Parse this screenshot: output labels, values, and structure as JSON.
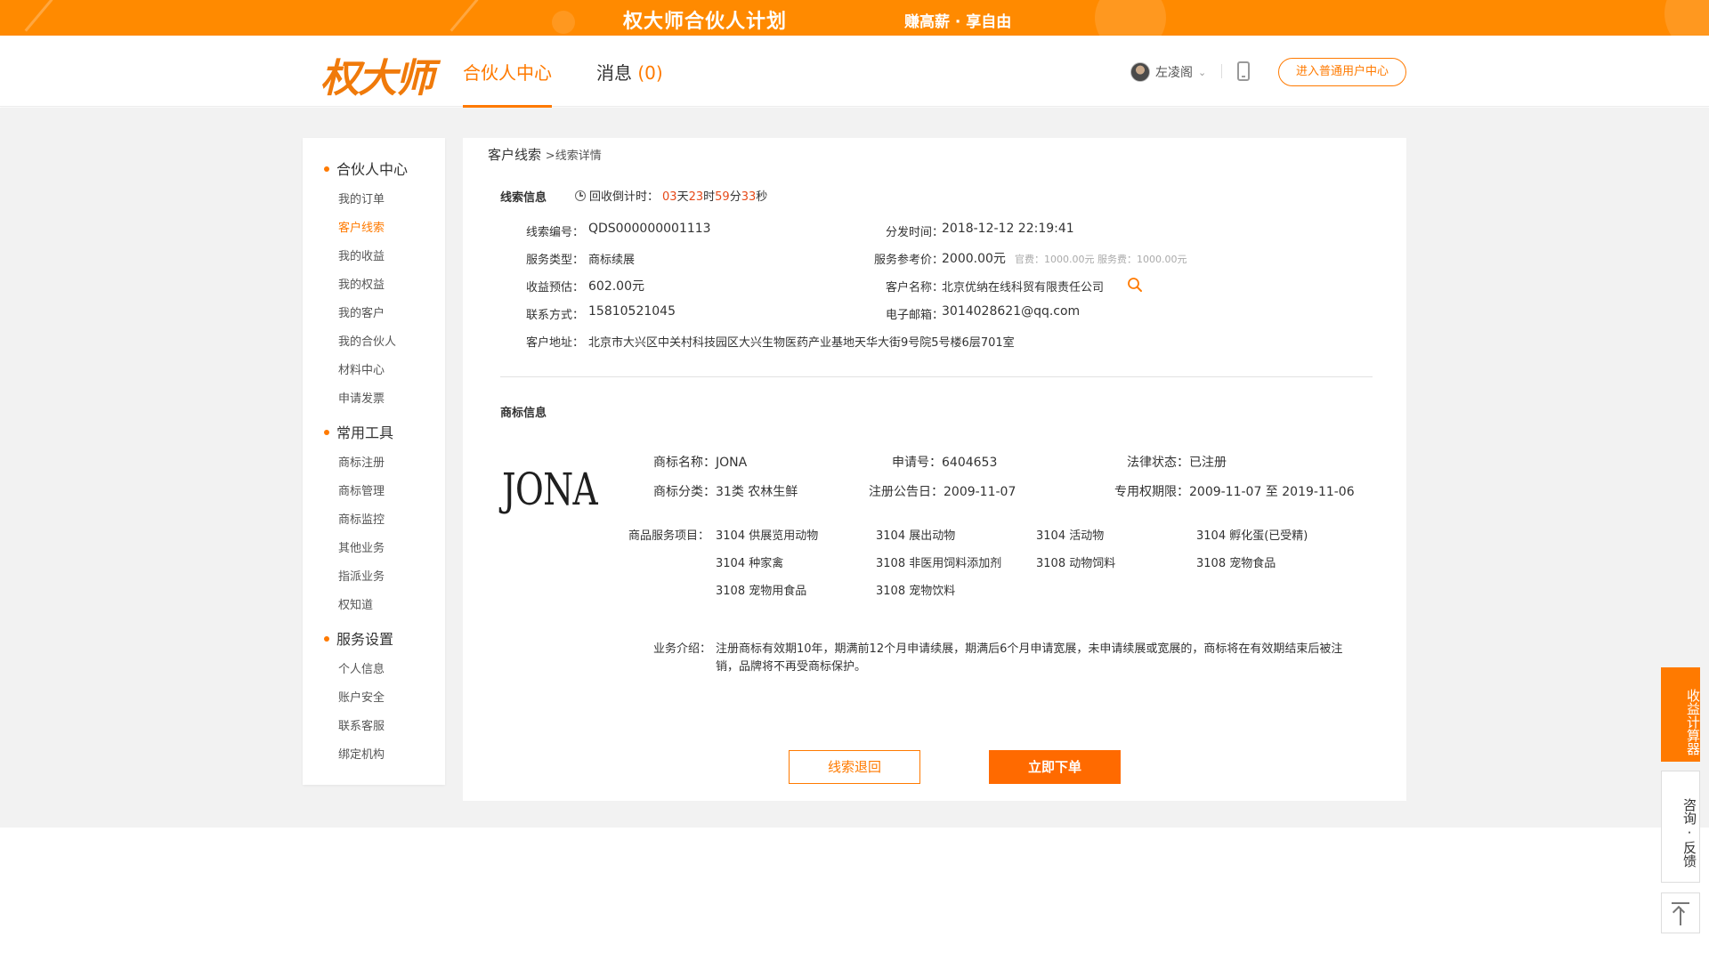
{
  "banner": {
    "title": "权大师合伙人计划",
    "slogan": "赚高薪 · 享自由"
  },
  "header": {
    "logo": "权大师",
    "nav_partner": "合伙人中心",
    "nav_messages": "消息",
    "nav_messages_count": "(0)",
    "username": "左凌阁",
    "user_center_button": "进入普通用户中心"
  },
  "sidebar": {
    "sections": [
      {
        "title": "合伙人中心",
        "items": [
          "我的订单",
          "客户线索",
          "我的收益",
          "我的权益",
          "我的客户",
          "我的合伙人",
          "材料中心",
          "申请发票"
        ]
      },
      {
        "title": "常用工具",
        "items": [
          "商标注册",
          "商标管理",
          "商标监控",
          "其他业务",
          "指派业务",
          "权知道"
        ]
      },
      {
        "title": "服务设置",
        "items": [
          "个人信息",
          "账户安全",
          "联系客服",
          "绑定机构"
        ]
      }
    ],
    "active_item": "客户线索"
  },
  "breadcrumb": {
    "parent": "客户线索",
    "current": ">线索详情"
  },
  "lead_info": {
    "heading": "线索信息",
    "countdown_label": "回收倒计时：",
    "days": "03",
    "days_unit": "天",
    "hours": "23",
    "hours_unit": "时",
    "minutes": "59",
    "minutes_unit": "分",
    "seconds": "33",
    "seconds_unit": "秒",
    "lead_no_label": "线索编号：",
    "lead_no": "QDS000000001113",
    "dispatch_time_label": "分发时间：",
    "dispatch_time": "2018-12-12 22:19:41",
    "service_type_label": "服务类型：",
    "service_type": "商标续展",
    "ref_price_label": "服务参考价：",
    "ref_price": "2000.00元",
    "fee_note": "官费：1000.00元 服务费：1000.00元",
    "income_label": "收益预估：",
    "income": "602.00元",
    "customer_name_label": "客户名称：",
    "customer_name": "北京优纳在线科贸有限责任公司",
    "contact_label": "联系方式：",
    "contact": "15810521045",
    "email_label": "电子邮箱：",
    "email": "3014028621@qq.com",
    "address_label": "客户地址：",
    "address": "北京市大兴区中关村科技园区大兴生物医药产业基地天华大街9号院5号楼6层701室"
  },
  "trademark": {
    "heading": "商标信息",
    "image_text": "JONA",
    "name": "商标名称：JONA",
    "app_no": "申请号：6404653",
    "legal_status": "法律状态：已注册",
    "category": "商标分类：31类 农林生鲜",
    "announce_date": "注册公告日：2009-11-07",
    "exclusive_period": "专用权期限：2009-11-07 至 2019-11-06",
    "goods_label": "商品服务项目：",
    "goods": [
      "3104 供展览用动物",
      "3104 展出动物",
      "3104 活动物",
      "3104 孵化蛋(已受精)",
      "3104 种家禽",
      "3108 非医用饲料添加剂",
      "3108 动物饲料",
      "3108 宠物食品",
      "3108 宠物用食品",
      "3108 宠物饮料"
    ],
    "intro_label": "业务介绍：",
    "intro": "注册商标有效期10年，期满前12个月申请续展，期满后6个月申请宽展，未申请续展或宽展的，商标将在有效期结束后被注销，品牌将不再受商标保护。"
  },
  "actions": {
    "return_button": "线索退回",
    "order_button": "立即下单"
  },
  "floating": {
    "calculator": "收益计算器",
    "consult": "咨询·反馈"
  },
  "colors": {
    "accent": "#ff7a00",
    "banner": "#ff8a00",
    "countdown_number": "#e64a19"
  }
}
